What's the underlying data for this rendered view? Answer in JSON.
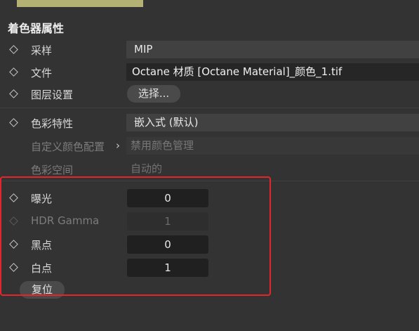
{
  "section_title": "着色器属性",
  "rows": {
    "sampling": {
      "label": "采样",
      "value": "MIP"
    },
    "file": {
      "label": "文件",
      "value": "Octane 材质 [Octane Material]_颜色_1.tif"
    },
    "layer_settings": {
      "label": "图层设置",
      "button": "选择..."
    },
    "color_profile": {
      "label": "色彩特性",
      "value": "嵌入式 (默认)"
    },
    "custom_color_config": {
      "label": "自定义颜色配置",
      "value": "禁用颜色管理"
    },
    "color_space": {
      "label": "色彩空间",
      "value": "自动的"
    },
    "exposure": {
      "label": "曝光",
      "value": "0"
    },
    "hdr_gamma": {
      "label": "HDR Gamma",
      "value": "1"
    },
    "black_point": {
      "label": "黑点",
      "value": "0"
    },
    "white_point": {
      "label": "白点",
      "value": "1"
    }
  },
  "reset_button": "复位",
  "colors": {
    "background": "#333333",
    "swatch": "#b3b173",
    "highlight": "#e3262b"
  }
}
